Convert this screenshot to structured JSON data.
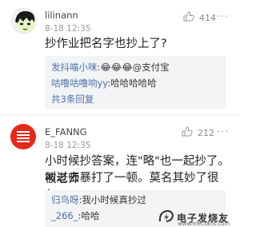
{
  "comments": [
    {
      "username": "lilinann",
      "time": "8-18 12:35",
      "likes": "414",
      "text": "抄作业把名字也抄上了?",
      "replies": [
        {
          "name": "发抖喵小咪",
          "text": ":😂😂😂@支付宝"
        },
        {
          "name": "咕噜咕噜响yy",
          "text": ":哈哈哈哈哈"
        }
      ],
      "replies_count": "共3条回复"
    },
    {
      "username": "E_FANNG",
      "time": "8-18 12:35",
      "likes": "212",
      "text_line1": "小时候抄答案，连\"略\"也一起抄了。被老师",
      "text_line2": "叫过去暴打了一顿。莫名其妙了很久。",
      "replies": [
        {
          "name": "归鸟呀",
          "text": ":我小时候真抄过"
        },
        {
          "name": "_266_",
          "text": ":哈哈"
        }
      ]
    }
  ],
  "watermark": {
    "name": "电子发烧友",
    "url": "www.elecfans.com"
  }
}
